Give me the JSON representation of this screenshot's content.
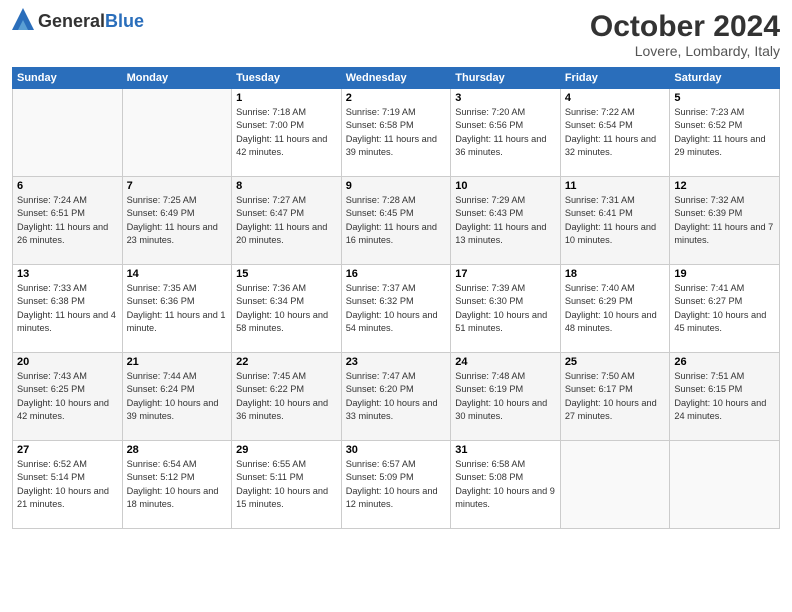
{
  "header": {
    "logo_general": "General",
    "logo_blue": "Blue",
    "month": "October 2024",
    "location": "Lovere, Lombardy, Italy"
  },
  "weekdays": [
    "Sunday",
    "Monday",
    "Tuesday",
    "Wednesday",
    "Thursday",
    "Friday",
    "Saturday"
  ],
  "weeks": [
    [
      {
        "day": "",
        "info": ""
      },
      {
        "day": "",
        "info": ""
      },
      {
        "day": "1",
        "info": "Sunrise: 7:18 AM\nSunset: 7:00 PM\nDaylight: 11 hours and 42 minutes."
      },
      {
        "day": "2",
        "info": "Sunrise: 7:19 AM\nSunset: 6:58 PM\nDaylight: 11 hours and 39 minutes."
      },
      {
        "day": "3",
        "info": "Sunrise: 7:20 AM\nSunset: 6:56 PM\nDaylight: 11 hours and 36 minutes."
      },
      {
        "day": "4",
        "info": "Sunrise: 7:22 AM\nSunset: 6:54 PM\nDaylight: 11 hours and 32 minutes."
      },
      {
        "day": "5",
        "info": "Sunrise: 7:23 AM\nSunset: 6:52 PM\nDaylight: 11 hours and 29 minutes."
      }
    ],
    [
      {
        "day": "6",
        "info": "Sunrise: 7:24 AM\nSunset: 6:51 PM\nDaylight: 11 hours and 26 minutes."
      },
      {
        "day": "7",
        "info": "Sunrise: 7:25 AM\nSunset: 6:49 PM\nDaylight: 11 hours and 23 minutes."
      },
      {
        "day": "8",
        "info": "Sunrise: 7:27 AM\nSunset: 6:47 PM\nDaylight: 11 hours and 20 minutes."
      },
      {
        "day": "9",
        "info": "Sunrise: 7:28 AM\nSunset: 6:45 PM\nDaylight: 11 hours and 16 minutes."
      },
      {
        "day": "10",
        "info": "Sunrise: 7:29 AM\nSunset: 6:43 PM\nDaylight: 11 hours and 13 minutes."
      },
      {
        "day": "11",
        "info": "Sunrise: 7:31 AM\nSunset: 6:41 PM\nDaylight: 11 hours and 10 minutes."
      },
      {
        "day": "12",
        "info": "Sunrise: 7:32 AM\nSunset: 6:39 PM\nDaylight: 11 hours and 7 minutes."
      }
    ],
    [
      {
        "day": "13",
        "info": "Sunrise: 7:33 AM\nSunset: 6:38 PM\nDaylight: 11 hours and 4 minutes."
      },
      {
        "day": "14",
        "info": "Sunrise: 7:35 AM\nSunset: 6:36 PM\nDaylight: 11 hours and 1 minute."
      },
      {
        "day": "15",
        "info": "Sunrise: 7:36 AM\nSunset: 6:34 PM\nDaylight: 10 hours and 58 minutes."
      },
      {
        "day": "16",
        "info": "Sunrise: 7:37 AM\nSunset: 6:32 PM\nDaylight: 10 hours and 54 minutes."
      },
      {
        "day": "17",
        "info": "Sunrise: 7:39 AM\nSunset: 6:30 PM\nDaylight: 10 hours and 51 minutes."
      },
      {
        "day": "18",
        "info": "Sunrise: 7:40 AM\nSunset: 6:29 PM\nDaylight: 10 hours and 48 minutes."
      },
      {
        "day": "19",
        "info": "Sunrise: 7:41 AM\nSunset: 6:27 PM\nDaylight: 10 hours and 45 minutes."
      }
    ],
    [
      {
        "day": "20",
        "info": "Sunrise: 7:43 AM\nSunset: 6:25 PM\nDaylight: 10 hours and 42 minutes."
      },
      {
        "day": "21",
        "info": "Sunrise: 7:44 AM\nSunset: 6:24 PM\nDaylight: 10 hours and 39 minutes."
      },
      {
        "day": "22",
        "info": "Sunrise: 7:45 AM\nSunset: 6:22 PM\nDaylight: 10 hours and 36 minutes."
      },
      {
        "day": "23",
        "info": "Sunrise: 7:47 AM\nSunset: 6:20 PM\nDaylight: 10 hours and 33 minutes."
      },
      {
        "day": "24",
        "info": "Sunrise: 7:48 AM\nSunset: 6:19 PM\nDaylight: 10 hours and 30 minutes."
      },
      {
        "day": "25",
        "info": "Sunrise: 7:50 AM\nSunset: 6:17 PM\nDaylight: 10 hours and 27 minutes."
      },
      {
        "day": "26",
        "info": "Sunrise: 7:51 AM\nSunset: 6:15 PM\nDaylight: 10 hours and 24 minutes."
      }
    ],
    [
      {
        "day": "27",
        "info": "Sunrise: 6:52 AM\nSunset: 5:14 PM\nDaylight: 10 hours and 21 minutes."
      },
      {
        "day": "28",
        "info": "Sunrise: 6:54 AM\nSunset: 5:12 PM\nDaylight: 10 hours and 18 minutes."
      },
      {
        "day": "29",
        "info": "Sunrise: 6:55 AM\nSunset: 5:11 PM\nDaylight: 10 hours and 15 minutes."
      },
      {
        "day": "30",
        "info": "Sunrise: 6:57 AM\nSunset: 5:09 PM\nDaylight: 10 hours and 12 minutes."
      },
      {
        "day": "31",
        "info": "Sunrise: 6:58 AM\nSunset: 5:08 PM\nDaylight: 10 hours and 9 minutes."
      },
      {
        "day": "",
        "info": ""
      },
      {
        "day": "",
        "info": ""
      }
    ]
  ]
}
